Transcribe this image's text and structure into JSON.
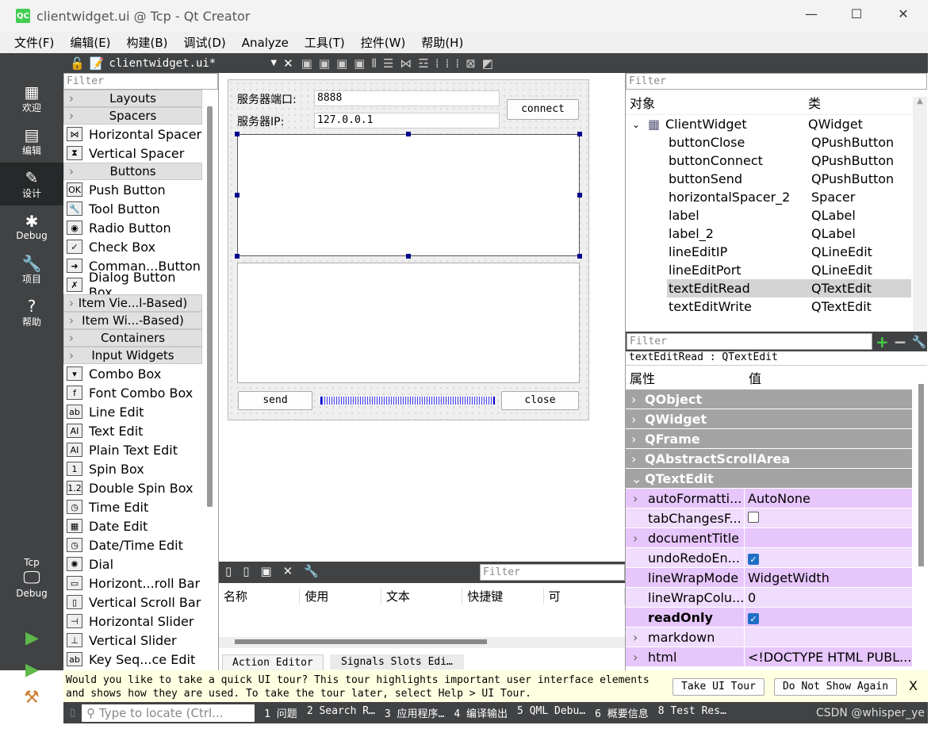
{
  "window": {
    "title": "clientwidget.ui @ Tcp - Qt Creator",
    "app_icon": "QC",
    "min": "—",
    "max": "☐",
    "close": "✕"
  },
  "menu": [
    "文件(F)",
    "编辑(E)",
    "构建(B)",
    "调试(D)",
    "Analyze",
    "工具(T)",
    "控件(W)",
    "帮助(H)"
  ],
  "toolbar": {
    "file": "clientwidget.ui*"
  },
  "modes": [
    {
      "label": "欢迎",
      "icon": "▦"
    },
    {
      "label": "编辑",
      "icon": "▤"
    },
    {
      "label": "设计",
      "icon": "✎"
    },
    {
      "label": "Debug",
      "icon": "✱"
    },
    {
      "label": "项目",
      "icon": "🔧"
    },
    {
      "label": "帮助",
      "icon": "?"
    }
  ],
  "kit": {
    "project": "Tcp",
    "build": "Debug"
  },
  "widgetbox": {
    "filter_placeholder": "Filter",
    "items": [
      {
        "t": "cat",
        "label": "Layouts"
      },
      {
        "t": "cat",
        "label": "Spacers"
      },
      {
        "label": "Horizontal Spacer",
        "icon": "⋈"
      },
      {
        "label": "Vertical Spacer",
        "icon": "⧗"
      },
      {
        "t": "cat",
        "label": "Buttons"
      },
      {
        "label": "Push Button",
        "icon": "OK"
      },
      {
        "label": "Tool Button",
        "icon": "🔧"
      },
      {
        "label": "Radio Button",
        "icon": "◉"
      },
      {
        "label": "Check Box",
        "icon": "✓"
      },
      {
        "label": "Comman...Button",
        "icon": "➜"
      },
      {
        "label": "Dialog Button Box",
        "icon": "✗"
      },
      {
        "t": "cat",
        "label": "Item Vie...l-Based)"
      },
      {
        "t": "cat",
        "label": "Item Wi...-Based)"
      },
      {
        "t": "cat",
        "label": "Containers"
      },
      {
        "t": "cat",
        "label": "Input Widgets"
      },
      {
        "label": "Combo Box",
        "icon": "▾"
      },
      {
        "label": "Font Combo Box",
        "icon": "f"
      },
      {
        "label": "Line Edit",
        "icon": "ab"
      },
      {
        "label": "Text Edit",
        "icon": "AI"
      },
      {
        "label": "Plain Text Edit",
        "icon": "AI"
      },
      {
        "label": "Spin Box",
        "icon": "1"
      },
      {
        "label": "Double Spin Box",
        "icon": "1.2"
      },
      {
        "label": "Time Edit",
        "icon": "◷"
      },
      {
        "label": "Date Edit",
        "icon": "▦"
      },
      {
        "label": "Date/Time Edit",
        "icon": "◷"
      },
      {
        "label": "Dial",
        "icon": "✺"
      },
      {
        "label": "Horizont...roll Bar",
        "icon": "▭"
      },
      {
        "label": "Vertical Scroll Bar",
        "icon": "▯"
      },
      {
        "label": "Horizontal Slider",
        "icon": "⊣"
      },
      {
        "label": "Vertical Slider",
        "icon": "⊥"
      },
      {
        "label": "Key Seq...ce Edit",
        "icon": "ab"
      }
    ]
  },
  "form": {
    "port_label": "服务器端口:",
    "port_value": "8888",
    "ip_label": "服务器IP:",
    "ip_value": "127.0.0.1",
    "connect": "connect",
    "send": "send",
    "close": "close"
  },
  "action_editor": {
    "filter_placeholder": "Filter",
    "columns": [
      "名称",
      "使用",
      "文本",
      "快捷键",
      "可"
    ],
    "tabs": [
      "Action Editor",
      "Signals  Slots Edi…"
    ]
  },
  "object_inspector": {
    "filter_placeholder": "Filter",
    "col_object": "对象",
    "col_class": "类",
    "root": {
      "name": "ClientWidget",
      "cls": "QWidget"
    },
    "rows": [
      {
        "name": "buttonClose",
        "cls": "QPushButton"
      },
      {
        "name": "buttonConnect",
        "cls": "QPushButton"
      },
      {
        "name": "buttonSend",
        "cls": "QPushButton"
      },
      {
        "name": "horizontalSpacer_2",
        "cls": "Spacer"
      },
      {
        "name": "label",
        "cls": "QLabel"
      },
      {
        "name": "label_2",
        "cls": "QLabel"
      },
      {
        "name": "lineEditIP",
        "cls": "QLineEdit"
      },
      {
        "name": "lineEditPort",
        "cls": "QLineEdit"
      },
      {
        "name": "textEditRead",
        "cls": "QTextEdit",
        "selected": true
      },
      {
        "name": "textEditWrite",
        "cls": "QTextEdit"
      }
    ]
  },
  "property_editor": {
    "filter_placeholder": "Filter",
    "context": "textEditRead : QTextEdit",
    "col_prop": "属性",
    "col_val": "值",
    "categories": [
      "QObject",
      "QWidget",
      "QFrame",
      "QAbstractScrollArea",
      "QTextEdit"
    ],
    "props": [
      {
        "name": "autoFormatti...",
        "value": "AutoNone",
        "expand": true
      },
      {
        "name": "tabChangesF...",
        "check": false
      },
      {
        "name": "documentTitle",
        "value": "",
        "expand": true
      },
      {
        "name": "undoRedoEn...",
        "check": true
      },
      {
        "name": "lineWrapMode",
        "value": "WidgetWidth"
      },
      {
        "name": "lineWrapColu...",
        "value": "0"
      },
      {
        "name": "readOnly",
        "check": true,
        "bold": true
      },
      {
        "name": "markdown",
        "value": "",
        "expand": true
      },
      {
        "name": "html",
        "value": "<!DOCTYPE HTML PUBL...",
        "expand": true
      }
    ]
  },
  "tour": {
    "text1": "Would you like to take a quick UI tour? This tour highlights important user interface elements",
    "text2": "and shows how they are used. To take the tour later, select Help > UI Tour.",
    "take": "Take UI Tour",
    "dont": "Do Not Show Again",
    "close": "X"
  },
  "status": {
    "locate_placeholder": "Type to locate (Ctrl...",
    "panes": [
      "1 问题",
      "2 Search R…",
      "3 应用程序…",
      "4 编译输出",
      "5 QML Debu…",
      "6 概要信息",
      "8 Test Res…"
    ],
    "watermark": "CSDN @whisper_ye"
  },
  "colors": {
    "dark": "#404244",
    "prop_purple": "#e6c6fb",
    "prop_purple_light": "#f0dcfd",
    "selection": "#d4d4d4"
  }
}
